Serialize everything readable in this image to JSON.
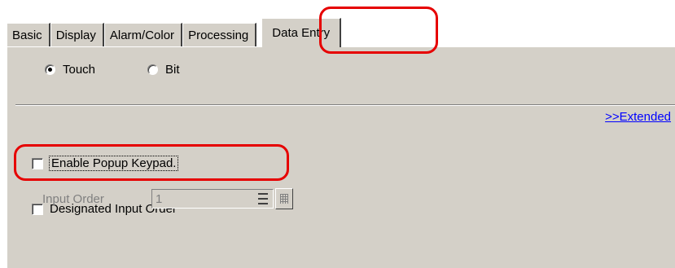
{
  "tabs": [
    {
      "label": "Basic"
    },
    {
      "label": "Display"
    },
    {
      "label": "Alarm/Color"
    },
    {
      "label": "Processing"
    },
    {
      "label": "Data Entry"
    }
  ],
  "active_tab": "Data Entry",
  "mode": {
    "options": [
      {
        "label": "Touch",
        "selected": true
      },
      {
        "label": "Bit",
        "selected": false
      }
    ]
  },
  "extended_link": ">>Extended",
  "options": {
    "popup_keypad": {
      "label": "Enable Popup Keypad.",
      "checked": false
    },
    "designated_input_order": {
      "label": "Designated Input Order",
      "checked": false
    }
  },
  "input_order": {
    "label": "Input Order",
    "value": "1",
    "enabled": false
  },
  "colors": {
    "panel": "#d4d0c8",
    "link": "#0000ff",
    "highlight": "#e60000"
  }
}
